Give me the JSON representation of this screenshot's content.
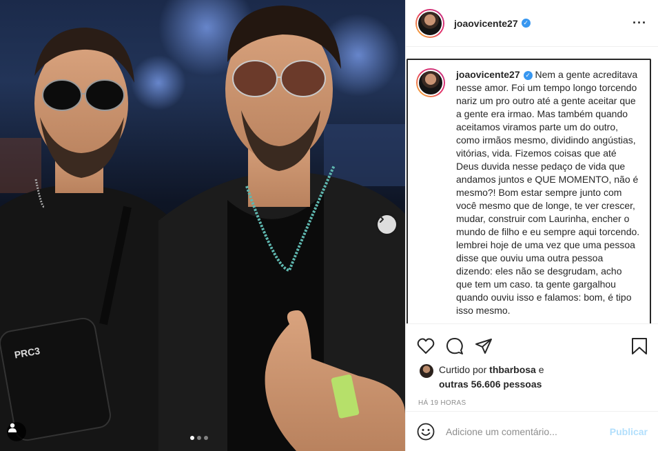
{
  "post": {
    "username": "joaovicente27",
    "verified": true,
    "caption": "Nem a gente acreditava nesse amor. Foi um tempo longo torcendo nariz um pro outro até a gente aceitar que a gente era irmao. Mas também quando aceitamos viramos parte um do outro, como irmãos mesmo, dividindo angústias, vitórias, vida. Fizemos coisas que até Deus duvida nesse pedaço de vida que andamos juntos e QUE MOMENTO, não é mesmo?! Bom estar sempre junto com você mesmo que de longe, te ver crescer, mudar, construir com Laurinha, encher o mundo de filho e eu sempre aqui torcendo. lembrei hoje de uma vez que uma pessoa disse que ouviu uma outra pessoa dizendo: eles não se desgrudam, acho que tem um caso. ta gente gargalhou quando ouviu isso e falamos: bom, é tipo isso mesmo.",
    "likes": {
      "prefix": "Curtido por",
      "by_user": "thbarbosa",
      "conjunction": "e",
      "others": "outras 56.606 pessoas"
    },
    "timestamp": "HÁ 19 HORAS"
  },
  "carousel": {
    "dots_total": 3,
    "active_index": 0
  },
  "comment_form": {
    "placeholder": "Adicione um comentário...",
    "publish_label": "Publicar"
  },
  "icons": {
    "more": "more-options-icon",
    "like": "heart-icon",
    "comment": "comment-icon",
    "share": "share-icon",
    "save": "bookmark-icon",
    "emoji": "emoji-icon",
    "next": "chevron-right-icon",
    "tags": "user-tag-icon"
  },
  "colors": {
    "verified": "#3897f0",
    "publish_disabled": "#b2dffc",
    "muted": "#8e8e8e"
  }
}
